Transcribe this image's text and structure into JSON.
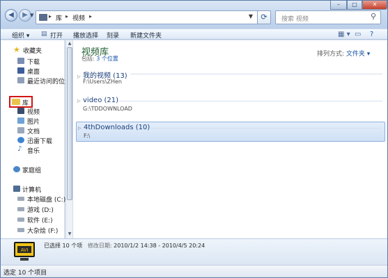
{
  "window": {
    "address": {
      "root": "库",
      "current": "视频"
    },
    "search_placeholder": "搜索 视频",
    "buttons": {
      "minimize": "–",
      "maximize": "□",
      "close": "✕"
    }
  },
  "toolbar": {
    "organize": "组织",
    "open": "打开",
    "play_selection": "播放选择",
    "burn": "刻录",
    "new_folder": "新建文件夹"
  },
  "sidebar": {
    "favorites": "收藏夹",
    "downloads": "下载",
    "desktop": "桌面",
    "recent": "最近访问的位置",
    "libraries": "库",
    "videos": "视频",
    "pictures": "图片",
    "documents": "文档",
    "thunder": "迅雷下载",
    "music": "音乐",
    "homegroup": "家庭组",
    "computer": "计算机",
    "drive_c": "本地磁盘 (C:)",
    "drive_d": "游戏 (D:)",
    "drive_e": "软件 (E:)",
    "drive_f": "大杂烩 (F:)"
  },
  "main": {
    "title": "视频库",
    "includes_label": "包括:",
    "includes_link": "3 个位置",
    "arrange_label": "排列方式:",
    "arrange_value": "文件夹 ▾",
    "groups": [
      {
        "name": "我的视频 (13)",
        "path": "F:\\Users\\ZHen"
      },
      {
        "name": "video (21)",
        "path": "G:\\TDDOWNLOAD"
      },
      {
        "name": "4thDownloads (10)",
        "path": "F:\\"
      }
    ]
  },
  "details": {
    "selected": "已选择 10 个项",
    "modified_label": "修改日期:",
    "modified_value": "2010/1/2 14:38 - 2010/4/5 20:24"
  },
  "status": {
    "text": "选定 10 个项目"
  },
  "colors": {
    "accent": "#1a56a8",
    "title_green": "#1e5c2e",
    "highlight": "#d21414"
  }
}
